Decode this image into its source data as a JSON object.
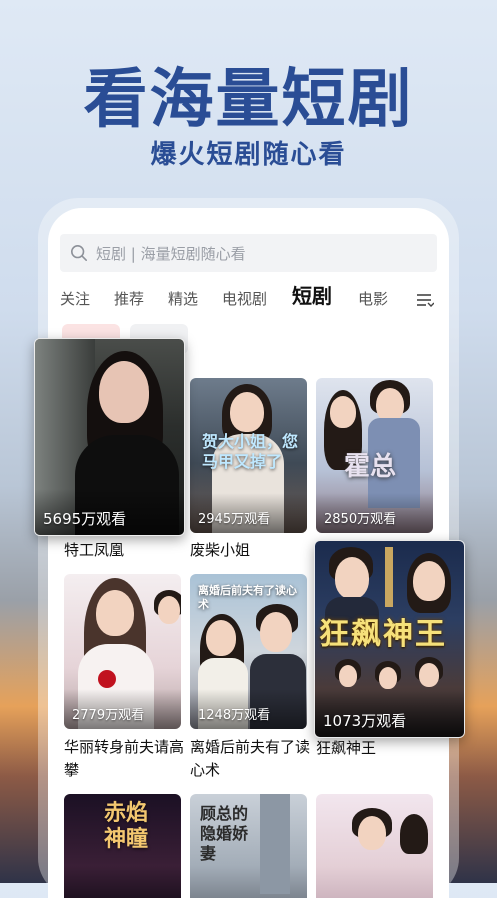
{
  "hero": {
    "title": "看海量短剧",
    "subtitle": "爆火短剧随心看"
  },
  "search": {
    "placeholder": "短剧 | 海量短剧随心看",
    "icon": "search-icon"
  },
  "tabs": [
    {
      "label": "关注",
      "active": false
    },
    {
      "label": "推荐",
      "active": false
    },
    {
      "label": "精选",
      "active": false
    },
    {
      "label": "电视剧",
      "active": false
    },
    {
      "label": "短剧",
      "active": true
    },
    {
      "label": "电影",
      "active": false
    }
  ],
  "dramas": [
    {
      "title": "特工凤凰",
      "views": "5695万观看"
    },
    {
      "title": "废柴小姐",
      "views": "2945万观看",
      "poster_text": "贺大小姐，您马甲又掉了"
    },
    {
      "title": "",
      "views": "2850万观看",
      "poster_text": "霍总"
    },
    {
      "title": "华丽转身前夫请高攀",
      "views": "2779万观看"
    },
    {
      "title": "离婚后前夫有了读心术",
      "views": "1248万观看",
      "poster_text": "离婚后前夫有了读心术"
    },
    {
      "title": "狂飙神王",
      "views": "1073万观看",
      "poster_text": "狂飙神王"
    },
    {
      "title": "",
      "views": "",
      "poster_text": "赤焰神瞳"
    },
    {
      "title": "",
      "views": "",
      "poster_text": "顾总的隐婚娇妻"
    },
    {
      "title": "",
      "views": "",
      "poster_text": ""
    }
  ],
  "colors": {
    "brand_blue": "#2a4d95",
    "chip_red": "#fbe3e3",
    "chip_gray": "#f0f1f3"
  }
}
